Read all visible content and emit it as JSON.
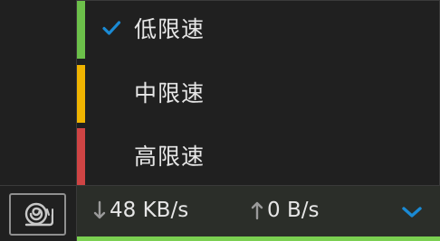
{
  "menu": {
    "items": [
      {
        "label": "低限速",
        "selected": true,
        "stripe_color": "#6cc04a",
        "check_icon": "checkmark-icon"
      },
      {
        "label": "中限速",
        "selected": false,
        "stripe_color": "#f0b400"
      },
      {
        "label": "高限速",
        "selected": false,
        "stripe_color": "#cf4444"
      }
    ]
  },
  "statusbar": {
    "snail_icon": "snail-icon",
    "download_speed": "48 KB/s",
    "upload_speed": "0 B/s",
    "download_icon": "arrow-down-icon",
    "upload_icon": "arrow-up-icon",
    "dropdown_icon": "chevron-down-icon",
    "accent_color": "#1a8ad4",
    "bar_color": "#7bd051"
  }
}
